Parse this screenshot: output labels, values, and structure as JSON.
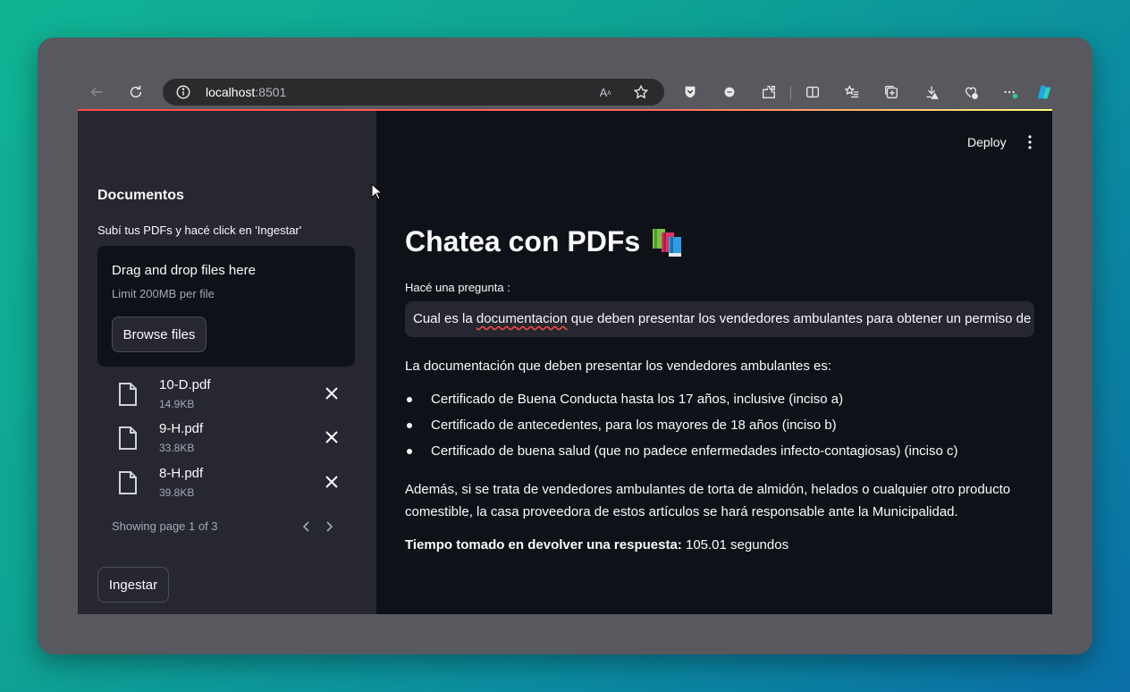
{
  "browser": {
    "url_host": "localhost",
    "url_port": ":8501"
  },
  "app": {
    "deploy_label": "Deploy",
    "sidebar": {
      "title": "Documentos",
      "description": "Subí tus PDFs y hacé click en 'Ingestar'",
      "dropzone_title": "Drag and drop files here",
      "dropzone_limit": "Limit 200MB per file",
      "browse_label": "Browse files",
      "files": [
        {
          "name": "10-D.pdf",
          "size": "14.9KB"
        },
        {
          "name": "9-H.pdf",
          "size": "33.8KB"
        },
        {
          "name": "8-H.pdf",
          "size": "39.8KB"
        }
      ],
      "pager_text": "Showing page 1 of 3",
      "ingest_label": "Ingestar"
    },
    "main": {
      "title": "Chatea con PDFs",
      "question_label": "Hacé una pregunta :",
      "question_pre": "Cual es la ",
      "question_misspelled": "documentacion",
      "question_post": " que deben presentar los vendedores ambulantes para obtener un permiso de",
      "answer_intro": "La documentación que deben presentar los vendedores ambulantes es:",
      "bullets": [
        "Certificado de Buena Conducta hasta los 17 años, inclusive (inciso a)",
        "Certificado de antecedentes, para los mayores de 18 años (inciso b)",
        "Certificado de buena salud (que no padece enfermedades infecto-contagiosas) (inciso c)"
      ],
      "answer_paragraph": "Además, si se trata de vendedores ambulantes de torta de almidón, helados o cualquier otro producto comestible, la casa proveedora de estos artículos se hará responsable ante la Municipalidad.",
      "timing_label": "Tiempo tomado en devolver una respuesta:",
      "timing_value": " 105.01 segundos"
    }
  },
  "colors": {
    "sidebar_bg": "#262730",
    "main_bg": "#0e1117",
    "accent": "#ff4b4b"
  }
}
